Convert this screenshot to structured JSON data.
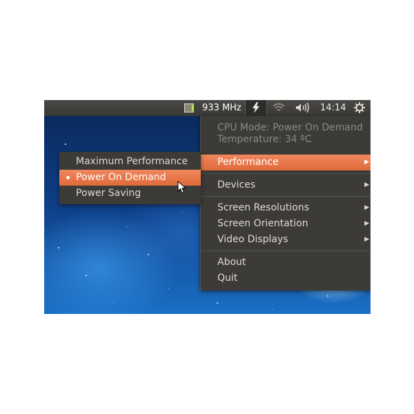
{
  "panel": {
    "cpu_freq": "933 MHz",
    "clock": "14:14",
    "icons": [
      "cpu-chip-icon",
      "lightning-icon",
      "wifi-icon",
      "volume-icon",
      "gear-icon"
    ]
  },
  "main_menu": {
    "cpu_mode": "CPU Mode: Power On Demand",
    "temperature": "Temperature: 34 ºC",
    "performance": "Performance",
    "devices": "Devices",
    "screen_resolutions": "Screen Resolutions",
    "screen_orientation": "Screen Orientation",
    "video_displays": "Video Displays",
    "about": "About",
    "quit": "Quit"
  },
  "sub_menu": {
    "items": [
      "Maximum Performance",
      "Power On Demand",
      "Power Saving"
    ],
    "selected": "Power On Demand"
  },
  "colors": {
    "panel_bg": "#3c3b37",
    "highlight": "#e8784a",
    "menu_text": "#dfdbd2"
  }
}
